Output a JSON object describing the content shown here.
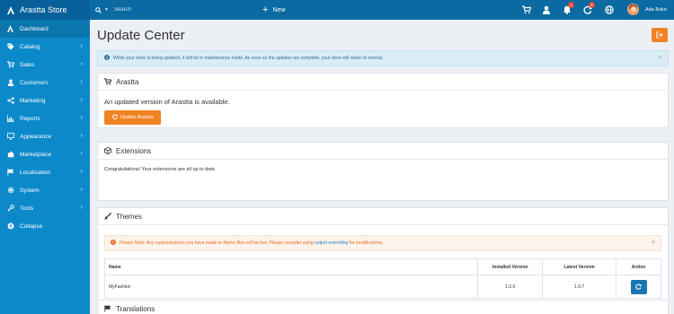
{
  "brand": "Arastta Store",
  "search": {
    "placeholder": "Search"
  },
  "new_label": "New",
  "top_badges": {
    "notifications": "1",
    "updates": "2"
  },
  "user": {
    "name": "Ada Bulut"
  },
  "sidebar": {
    "items": [
      {
        "label": "Dashboard",
        "icon": "dashboard-icon",
        "chevron": false
      },
      {
        "label": "Catalog",
        "icon": "tag-icon",
        "chevron": true
      },
      {
        "label": "Sales",
        "icon": "cart-icon",
        "chevron": true
      },
      {
        "label": "Customers",
        "icon": "user-icon",
        "chevron": true
      },
      {
        "label": "Marketing",
        "icon": "share-icon",
        "chevron": true
      },
      {
        "label": "Reports",
        "icon": "bar-chart-icon",
        "chevron": true
      },
      {
        "label": "Appearance",
        "icon": "desktop-icon",
        "chevron": true
      },
      {
        "label": "Marketplace",
        "icon": "puzzle-icon",
        "chevron": true
      },
      {
        "label": "Localisation",
        "icon": "flag-icon",
        "chevron": true
      },
      {
        "label": "System",
        "icon": "gear-icon",
        "chevron": true
      },
      {
        "label": "Tools",
        "icon": "wrench-icon",
        "chevron": true
      },
      {
        "label": "Collapse",
        "icon": "collapse-icon",
        "chevron": false
      }
    ]
  },
  "page": {
    "title": "Update Center",
    "info_alert": "While your store is being updated, it will be in maintenance mode. As soon as the updates are complete, your store will return to normal."
  },
  "arastta_panel": {
    "title": "Arastta",
    "message": "An updated version of Arastta is available.",
    "button": "Update Arastta"
  },
  "extensions_panel": {
    "title": "Extensions",
    "message": "Congratulations! Your extensions are all up to date."
  },
  "themes_panel": {
    "title": "Themes",
    "warning_prefix": "Please Note: Any customizations you have made to theme files will be lost. Please consider using ",
    "warning_link": "output overriding",
    "warning_suffix": " for modifications.",
    "columns": [
      "Name",
      "Installed Version",
      "Latest Version",
      "Action"
    ],
    "rows": [
      {
        "name": "MyFashion",
        "installed": "1.0.0",
        "latest": "1.0.7"
      }
    ]
  },
  "translations_panel": {
    "title": "Translations"
  },
  "colors": {
    "topbar": "#0a6aa1",
    "sidebar": "#0c89c9",
    "accent_orange": "#f08424",
    "action_blue": "#1677b1"
  }
}
